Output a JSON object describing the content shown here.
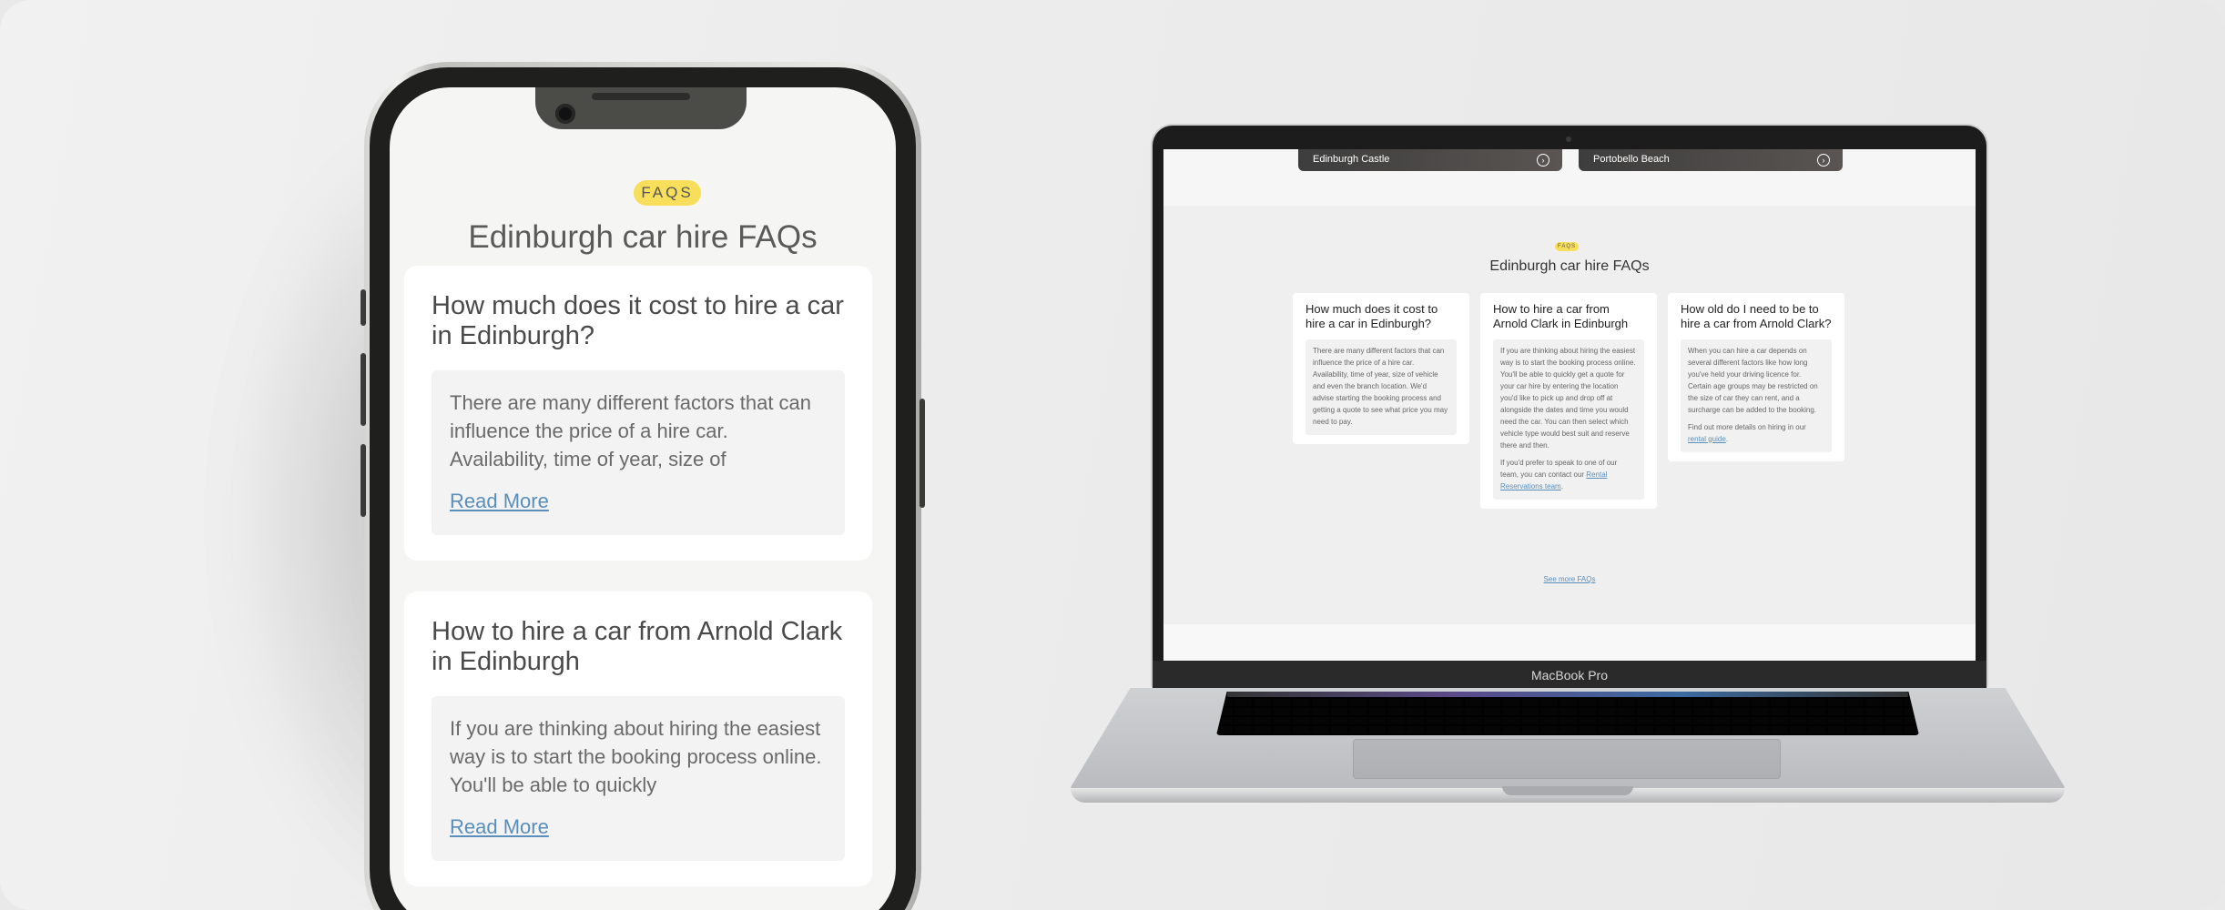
{
  "mobile": {
    "badge": "FAQS",
    "title": "Edinburgh car hire FAQs",
    "faqs": [
      {
        "question": "How much does it cost to hire a car in Edinburgh?",
        "answer": "There are many different factors that can influence the price of a hire car. Availability, time of year, size of",
        "link": "Read More"
      },
      {
        "question": "How to hire a car from Arnold Clark in Edinburgh",
        "answer": "If you are thinking about hiring the easiest way is to start the booking process online. You'll be able to quickly",
        "link": "Read More"
      }
    ]
  },
  "laptop": {
    "brand": "MacBook Pro",
    "hero_cards": [
      "Edinburgh Castle",
      "Portobello Beach"
    ],
    "badge": "FAQS",
    "title": "Edinburgh car hire FAQs",
    "faqs": [
      {
        "question": "How much does it cost to hire a car in Edinburgh?",
        "paragraphs": [
          "There are many different factors that can influence the price of a hire car. Availability, time of year, size of vehicle and even the branch location. We'd advise starting the booking process and getting a quote to see what price you may need to pay."
        ]
      },
      {
        "question": "How to hire a car from Arnold Clark in Edinburgh",
        "paragraphs": [
          "If you are thinking about hiring the easiest way is to start the booking process online. You'll be able to quickly get a quote for your car hire by entering the location you'd like to pick up and drop off at alongside the dates and time you would need the car. You can then select which vehicle type would best suit and reserve there and then.",
          "If you'd prefer to speak to one of our team, you can contact our"
        ],
        "link": "Rental Reservations team",
        "link_suffix": "."
      },
      {
        "question": "How old do I need to be to hire a car from Arnold Clark?",
        "paragraphs": [
          "When you can hire a car depends on several different factors like how long you've held your driving licence for. Certain age groups may be restricted on the size of car they can rent, and a surcharge can be added to the booking.",
          "Find out more details on hiring in our"
        ],
        "link": "rental guide",
        "link_suffix": "."
      }
    ],
    "see_more": "See more FAQs"
  }
}
